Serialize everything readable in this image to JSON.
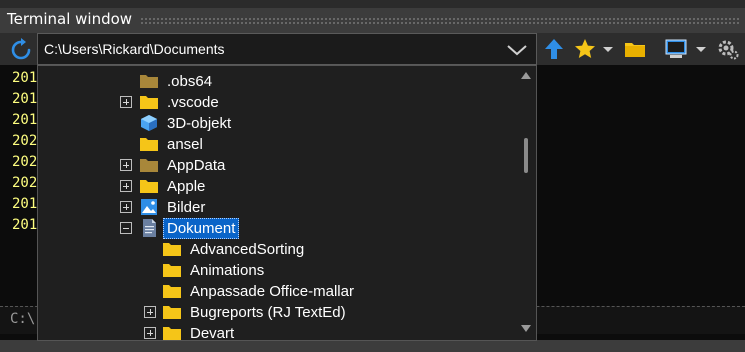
{
  "window": {
    "title": "Terminal window"
  },
  "toolbar": {
    "path": "C:\\Users\\Rickard\\Documents",
    "icons": [
      "refresh-icon",
      "up-arrow-icon",
      "star-icon",
      "folder-icon",
      "monitor-icon",
      "gear-icon"
    ]
  },
  "terminal": {
    "lines": [
      "201",
      "201",
      "201",
      "202",
      "202",
      "202",
      "201",
      "201"
    ],
    "prompt": "C:\\"
  },
  "tree": {
    "items": [
      {
        "label": ".obs64",
        "expander": "none",
        "icon": "folder-dark"
      },
      {
        "label": ".vscode",
        "expander": "plus",
        "icon": "folder"
      },
      {
        "label": "3D-objekt",
        "expander": "none",
        "icon": "cube"
      },
      {
        "label": "ansel",
        "expander": "none",
        "icon": "folder"
      },
      {
        "label": "AppData",
        "expander": "plus",
        "icon": "folder-dark"
      },
      {
        "label": "Apple",
        "expander": "plus",
        "icon": "folder"
      },
      {
        "label": "Bilder",
        "expander": "plus",
        "icon": "pictures"
      },
      {
        "label": "Dokument",
        "expander": "minus",
        "icon": "document",
        "selected": true
      },
      {
        "label": "AdvancedSorting",
        "expander": "none",
        "icon": "folder"
      },
      {
        "label": "Animations",
        "expander": "none",
        "icon": "folder"
      },
      {
        "label": "Anpassade Office-mallar",
        "expander": "none",
        "icon": "folder"
      },
      {
        "label": "Bugreports (RJ TextEd)",
        "expander": "plus",
        "icon": "folder"
      },
      {
        "label": "Devart",
        "expander": "plus",
        "icon": "folder"
      }
    ]
  },
  "colors": {
    "accent": "#0a64c8",
    "folder": "#f5c518",
    "folder_dark": "#a8873a",
    "terminal_text": "#ffff80",
    "icon_blue": "#2f8ee6"
  }
}
